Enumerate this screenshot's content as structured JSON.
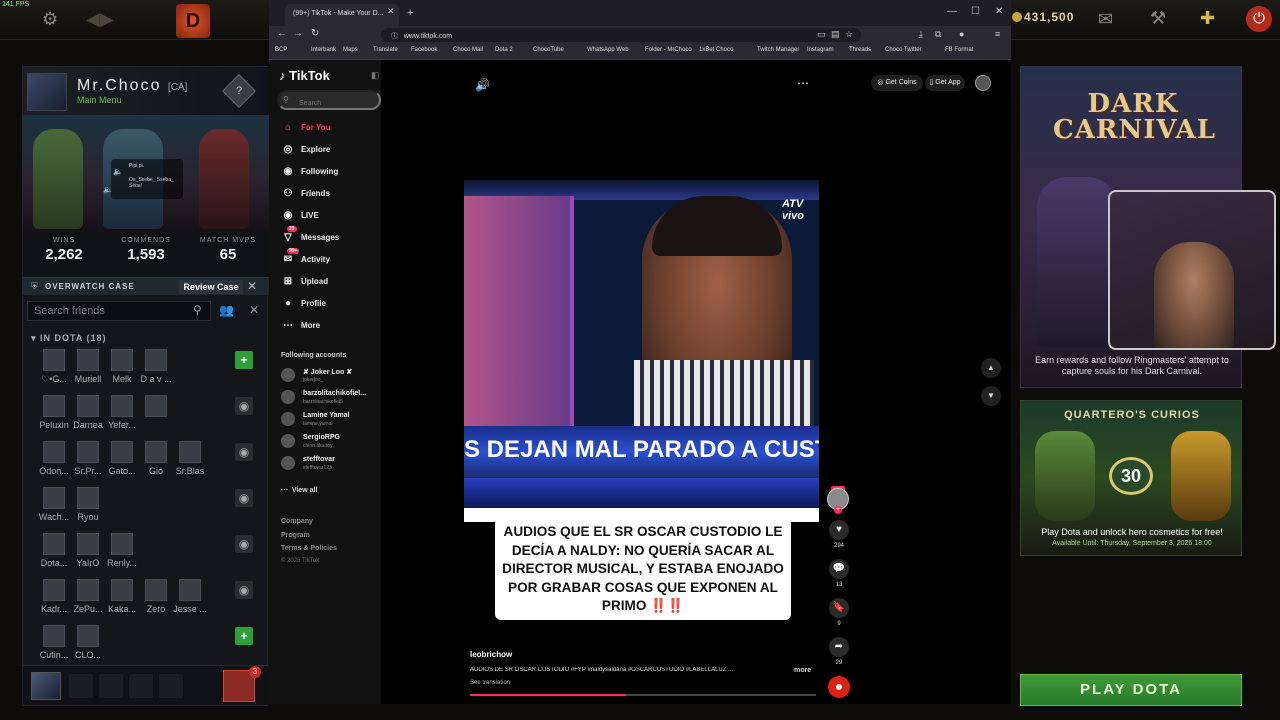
{
  "fps": "141 FPS",
  "dota": {
    "gold": "431,500",
    "profile": {
      "name": "Mr.Choco",
      "tag": "[CA]",
      "status": "Main Menu",
      "rank_badge": "?",
      "hero_card": {
        "line1": "Pipi pi.",
        "line2": "Oe_Ssebe_ Sseba_ Seba!"
      },
      "stats": [
        {
          "label": "WINS",
          "value": "2,262"
        },
        {
          "label": "COMMENDS",
          "value": "1,593"
        },
        {
          "label": "MATCH MVPS",
          "value": "65"
        }
      ]
    },
    "overwatch": {
      "label": "OVERWATCH CASE",
      "button": "Review Case",
      "close": "✕"
    },
    "friends_search_placeholder": "Search friends",
    "in_dota_header": "IN DOTA (18)",
    "friends": [
      [
        "♡•G...",
        "Muriell",
        "Melk",
        "D a v ..."
      ],
      [
        "Peluxin",
        "Darnea",
        "Yefer...",
        ""
      ],
      [
        "Odon...",
        "Sr.Pr...",
        "Gato...",
        "Gio",
        "Sr.Blas"
      ],
      [
        "Wach...",
        "Ryou"
      ],
      [
        "Dota...",
        "YaIrO",
        "Renly..."
      ],
      [
        "Kadr...",
        "ZePu...",
        "Kaka...",
        "Zero",
        "Jesse ..."
      ],
      [
        "Cutin...",
        "CLO..."
      ]
    ],
    "row_buttons": [
      "+",
      "◉",
      "◉",
      "◉",
      "◉",
      "◉",
      "+"
    ],
    "notification_count": "3",
    "carnival": {
      "title_line1": "DARK",
      "title_line2": "CARNIVAL",
      "text": "Earn rewards and follow Ringmasters' attempt to capture souls for his Dark Carnival."
    },
    "curios": {
      "title": "QUARTERO'S CURIOS",
      "level": "30",
      "text": "Play Dota and unlock hero cosmetics for free!",
      "available": "Available Until: Thursday, September 3, 2026 18:00"
    },
    "play_button": "PLAY DOTA"
  },
  "browser": {
    "tab_title": "(99+) TikTok - Make Your D...",
    "url": "www.tiktok.com",
    "bookmarks": [
      "BCP",
      "Interbank",
      "Maps",
      "Translate",
      "Facebook",
      "Choco Mail",
      "Dota 2",
      "ChocoTube",
      "WhatsApp Web",
      "Folder - MrChoco",
      "1xBet Choco",
      "Twitch Manager",
      "Instagram",
      "Threads",
      "Choco Twitter",
      "FB Format"
    ]
  },
  "tiktok": {
    "logo": "TikTok",
    "search_placeholder": "Search",
    "nav": [
      {
        "label": "For You",
        "icon": "⌂"
      },
      {
        "label": "Explore",
        "icon": "◎"
      },
      {
        "label": "Following",
        "icon": "◉"
      },
      {
        "label": "Friends",
        "icon": "⚇"
      },
      {
        "label": "LIVE",
        "icon": "◉"
      },
      {
        "label": "Messages",
        "icon": "▽"
      },
      {
        "label": "Activity",
        "icon": "✉"
      },
      {
        "label": "Upload",
        "icon": "⊞"
      },
      {
        "label": "Profile",
        "icon": "●"
      },
      {
        "label": "More",
        "icon": "⋯"
      }
    ],
    "badges": {
      "messages": "23",
      "activity": "99+"
    },
    "following_header": "Following accounts",
    "accounts": [
      {
        "name": "✘ Joker Loo ✘",
        "handle": "jokerloo_"
      },
      {
        "name": "barzolitachikofiel...",
        "handle": "barzolitachikofiel5"
      },
      {
        "name": "Lamine Yamal",
        "handle": "lamine.yamal"
      },
      {
        "name": "SergioRPG",
        "handle": "chino.aka.toy"
      },
      {
        "name": "stefftovar",
        "handle": "stefftovar123"
      }
    ],
    "see_all": "View all",
    "footer": [
      "Company",
      "Program",
      "Terms & Policies"
    ],
    "copyright": "© 2026 TikTok",
    "get_coins": "Get Coins",
    "get_app": "Get App",
    "video": {
      "logo": "ATV vivo",
      "banner": "S DEJAN MAL PARADO A CUSTODIO",
      "caption": "AUDIOS QUE EL SR OSCAR CUSTODIO LE DECÍA A NALDY: NO QUERÍA SACAR AL DIRECTOR MUSICAL, Y ESTABA ENOJADO POR GRABAR COSAS  QUE EXPONEN AL PRIMO",
      "caption_excl": "‼️‼️"
    },
    "author": "leobrichow",
    "description": "AUDIOS DE SR OSCAR CUSTODIO #FYP #naldysaldaña #OSCARCUSTODIO #LABELLALUZ ...",
    "more": "more",
    "translate": "See translation",
    "live_label": "LIVE",
    "actions": {
      "likes": "294",
      "comments": "13",
      "saves": "9",
      "shares": "29"
    },
    "progress": 0.45
  }
}
